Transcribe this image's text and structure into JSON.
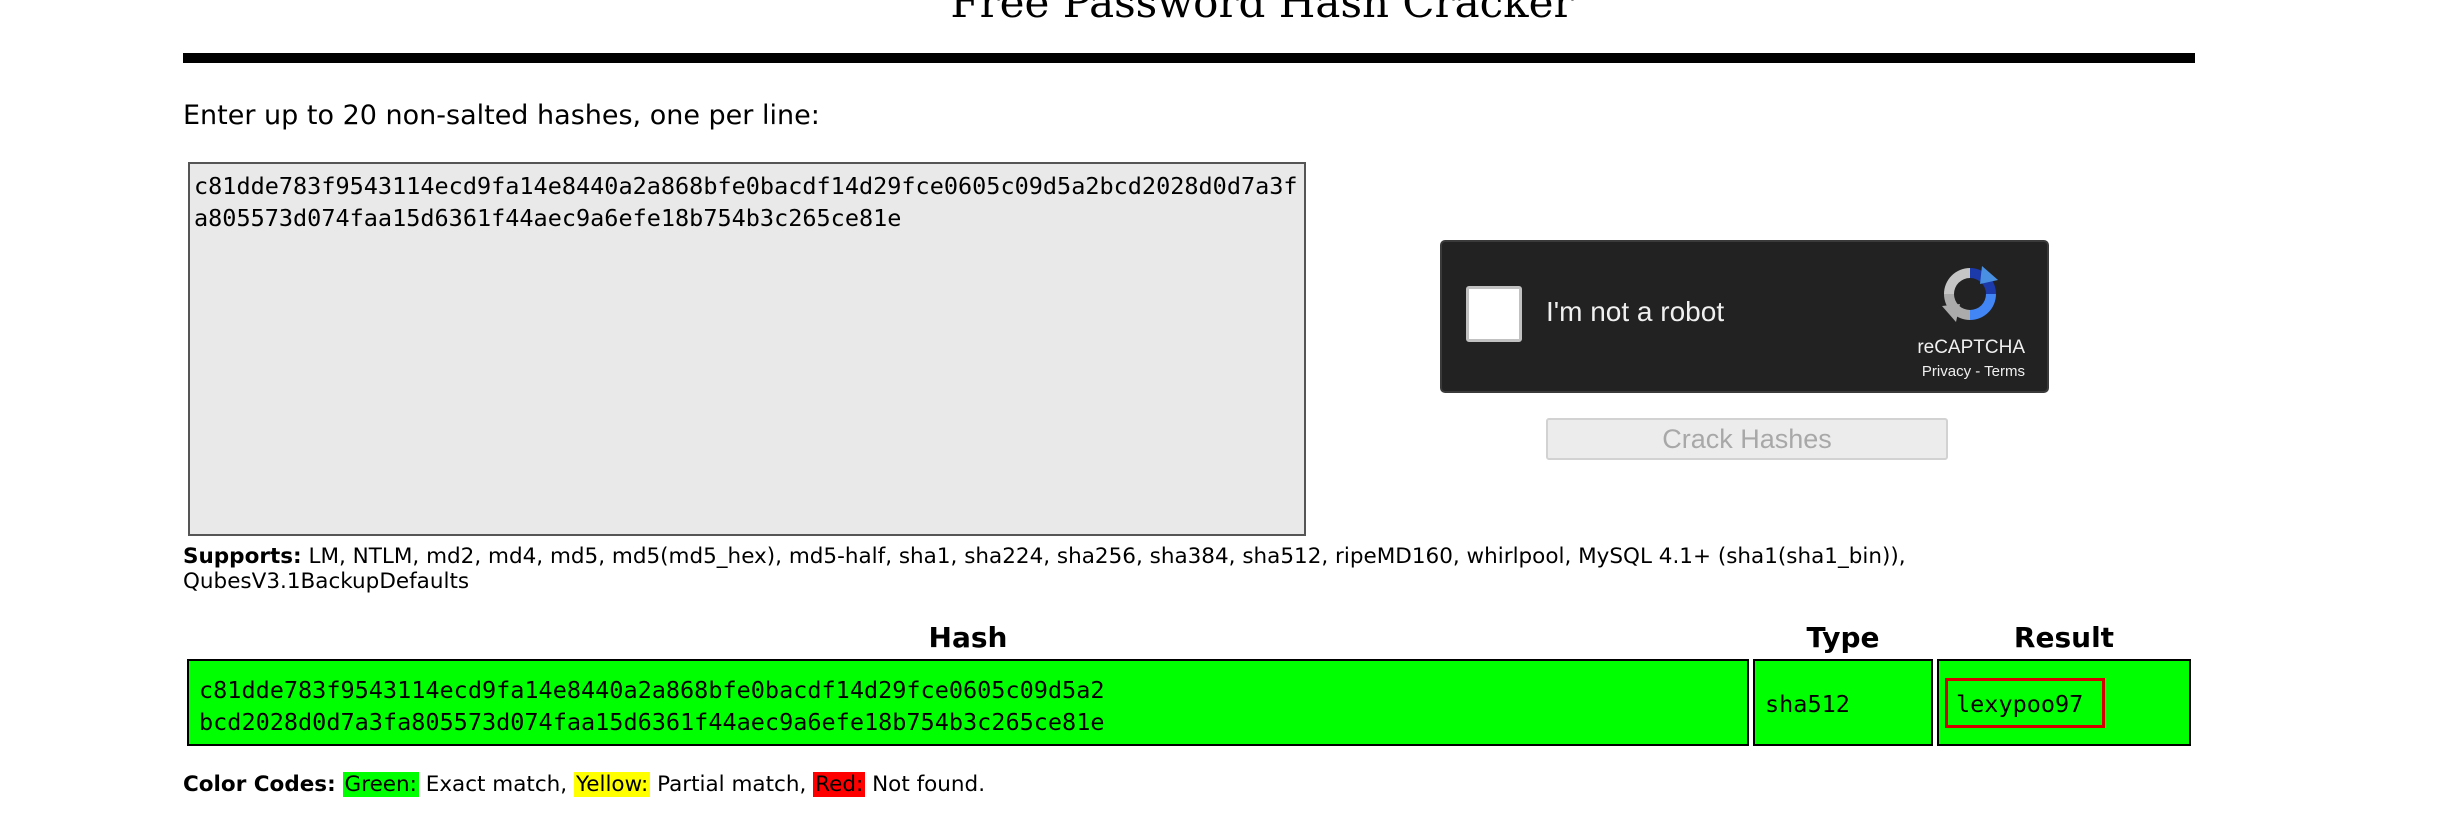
{
  "page": {
    "title": "Free Password Hash Cracker",
    "instructions": "Enter up to 20 non-salted hashes, one per line:"
  },
  "form": {
    "hash_input_value": "c81dde783f9543114ecd9fa14e8440a2a868bfe0bacdf14d29fce0605c09d5a2bcd2028d0d7a3fa805573d074faa15d6361f44aec9a6efe18b754b3c265ce81e",
    "crack_button_label": "Crack Hashes"
  },
  "captcha": {
    "label": "I'm not a robot",
    "brand": "reCAPTCHA",
    "privacy_link": "Privacy",
    "separator": " - ",
    "terms_link": "Terms",
    "icon": "recaptcha-logo-icon"
  },
  "supports": {
    "label": "Supports:",
    "list": " LM, NTLM, md2, md4, md5, md5(md5_hex), md5-half, sha1, sha224, sha256, sha384, sha512, ripeMD160, whirlpool, MySQL 4.1+ (sha1(sha1_bin)), QubesV3.1BackupDefaults"
  },
  "results": {
    "columns": [
      "Hash",
      "Type",
      "Result"
    ],
    "rows": [
      {
        "hash": "c81dde783f9543114ecd9fa14e8440a2a868bfe0bacdf14d29fce0605c09d5a2\nbcd2028d0d7a3fa805573d074faa15d6361f44aec9a6efe18b754b3c265ce81e",
        "type": "sha512",
        "result": "lexypoo97",
        "status_color": "#00ff00"
      }
    ]
  },
  "color_codes": {
    "label": "Color Codes:",
    "green_label": "Green:",
    "green_text": " Exact match, ",
    "yellow_label": "Yellow:",
    "yellow_text": " Partial match, ",
    "red_label": "Red:",
    "red_text": " Not found.",
    "colors": {
      "green": "#00ff00",
      "yellow": "#ffff00",
      "red": "#ff0000"
    }
  }
}
